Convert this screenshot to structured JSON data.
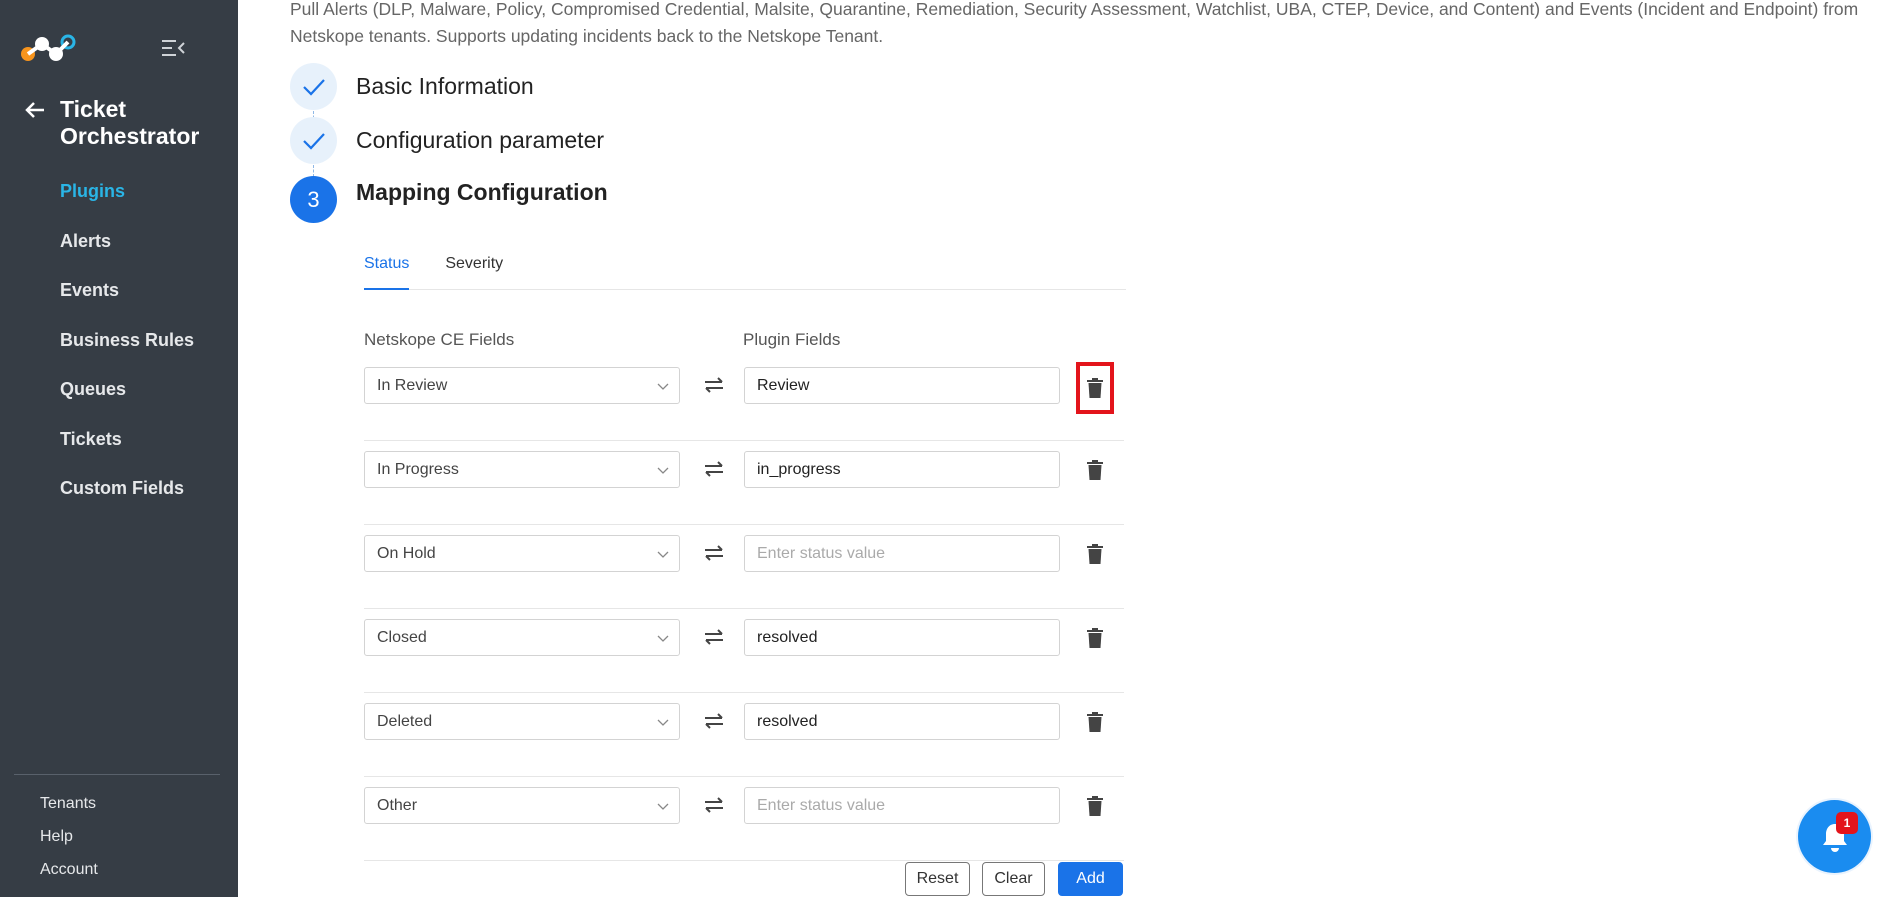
{
  "sidebar": {
    "module_title": "Ticket Orchestrator",
    "nav_items": [
      {
        "label": "Plugins",
        "active": true
      },
      {
        "label": "Alerts"
      },
      {
        "label": "Events"
      },
      {
        "label": "Business Rules"
      },
      {
        "label": "Queues"
      },
      {
        "label": "Tickets"
      },
      {
        "label": "Custom Fields"
      }
    ],
    "bottom_items": [
      "Tenants",
      "Help",
      "Account"
    ]
  },
  "main": {
    "description": "Pull Alerts (DLP, Malware, Policy, Compromised Credential, Malsite, Quarantine, Remediation, Security Assessment, Watchlist, UBA, CTEP, Device, and Content) and Events (Incident and Endpoint) from Netskope tenants. Supports updating incidents back to the Netskope Tenant.",
    "steps": [
      {
        "label": "Basic Information",
        "status": "done"
      },
      {
        "label": "Configuration parameter",
        "status": "done"
      },
      {
        "number": "3",
        "label": "Mapping Configuration",
        "status": "current"
      }
    ],
    "tabs": [
      {
        "label": "Status",
        "active": true
      },
      {
        "label": "Severity"
      }
    ],
    "col_headers": {
      "left": "Netskope CE Fields",
      "right": "Plugin Fields"
    },
    "rows": [
      {
        "ce_field": "In Review",
        "plugin_value": "Review",
        "placeholder": "Enter status value"
      },
      {
        "ce_field": "In Progress",
        "plugin_value": "in_progress",
        "placeholder": "Enter status value"
      },
      {
        "ce_field": "On Hold",
        "plugin_value": "",
        "placeholder": "Enter status value"
      },
      {
        "ce_field": "Closed",
        "plugin_value": "resolved",
        "placeholder": "Enter status value"
      },
      {
        "ce_field": "Deleted",
        "plugin_value": "resolved",
        "placeholder": "Enter status value"
      },
      {
        "ce_field": "Other",
        "plugin_value": "",
        "placeholder": "Enter status value"
      }
    ],
    "buttons": {
      "reset": "Reset",
      "clear": "Clear",
      "add": "Add"
    }
  },
  "notifications": {
    "count": "1"
  },
  "colors": {
    "primary": "#1a73e8",
    "sidebar_bg": "#363d45",
    "active_nav": "#2ab5e6",
    "highlight": "#e3141b"
  }
}
